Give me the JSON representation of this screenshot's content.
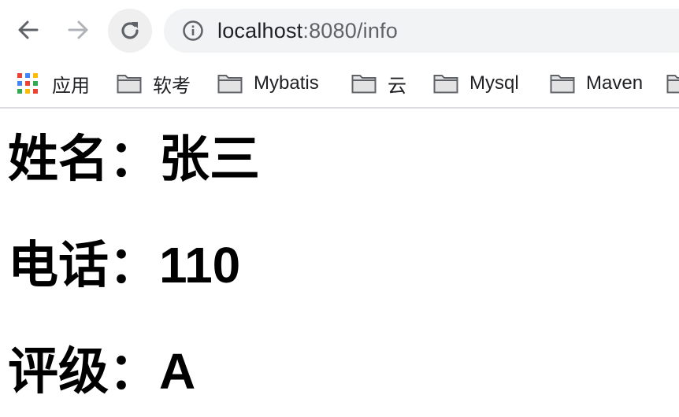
{
  "browser": {
    "url_host": "localhost",
    "url_rest": ":8080/info"
  },
  "bookmarks": [
    {
      "label": "应用",
      "icon": "apps-grid-icon"
    },
    {
      "label": "软考",
      "icon": "folder-icon"
    },
    {
      "label": "Mybatis",
      "icon": "folder-icon"
    },
    {
      "label": "云",
      "icon": "folder-icon"
    },
    {
      "label": "Mysql",
      "icon": "folder-icon"
    },
    {
      "label": "Maven",
      "icon": "folder-icon"
    }
  ],
  "info": {
    "name_label": "姓名：",
    "name_value": "张三",
    "phone_label": "电话：",
    "phone_value": "110",
    "rating_label": "评级：",
    "rating_value": "A"
  }
}
